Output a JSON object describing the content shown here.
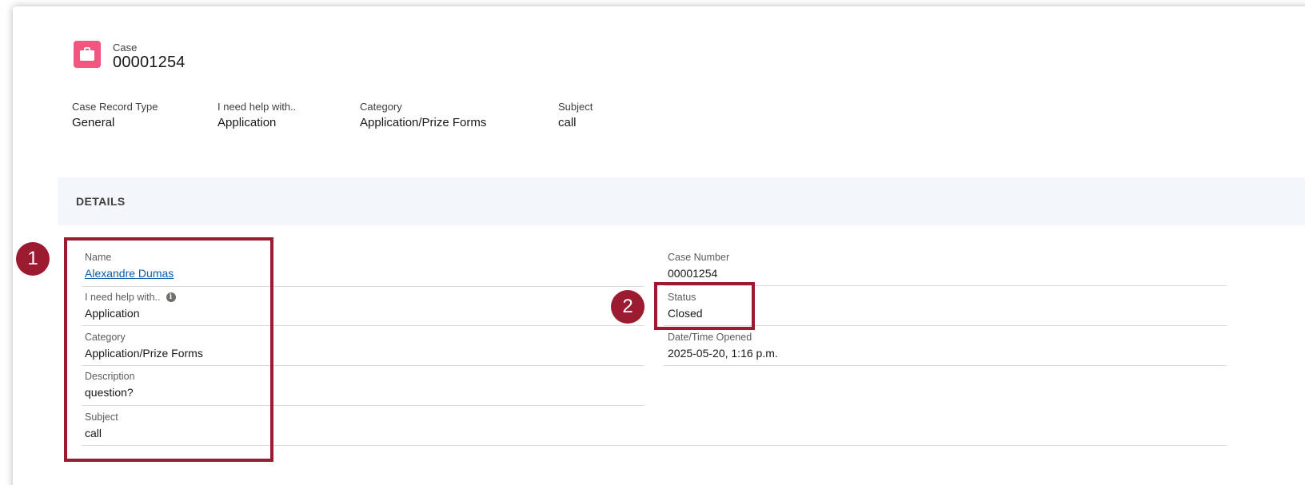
{
  "record": {
    "object_label": "Case",
    "number": "00001254",
    "icon": "briefcase-icon",
    "icon_color": "#f2557f"
  },
  "highlights": [
    {
      "label": "Case Record Type",
      "value": "General"
    },
    {
      "label": "I need help with..",
      "value": "Application"
    },
    {
      "label": "Category",
      "value": "Application/Prize Forms"
    },
    {
      "label": "Subject",
      "value": "call"
    }
  ],
  "details": {
    "section_title": "DETAILS",
    "left": [
      {
        "label": "Name",
        "value": "Alexandre Dumas"
      },
      {
        "label": "I need help with..",
        "value": "Application"
      },
      {
        "label": "Category",
        "value": "Application/Prize Forms"
      },
      {
        "label": "Description",
        "value": "question?"
      },
      {
        "label": "Subject",
        "value": "call"
      }
    ],
    "right": [
      {
        "label": "Case Number",
        "value": "00001254"
      },
      {
        "label": "Status",
        "value": "Closed"
      },
      {
        "label": "Date/Time Opened",
        "value": "2025-05-20, 1:16 p.m."
      }
    ]
  },
  "annotations": [
    {
      "number": "1"
    },
    {
      "number": "2"
    }
  ],
  "colors": {
    "annotation": "#9b1c31",
    "link": "#0b5cab",
    "section_bg": "#f3f6fa"
  }
}
